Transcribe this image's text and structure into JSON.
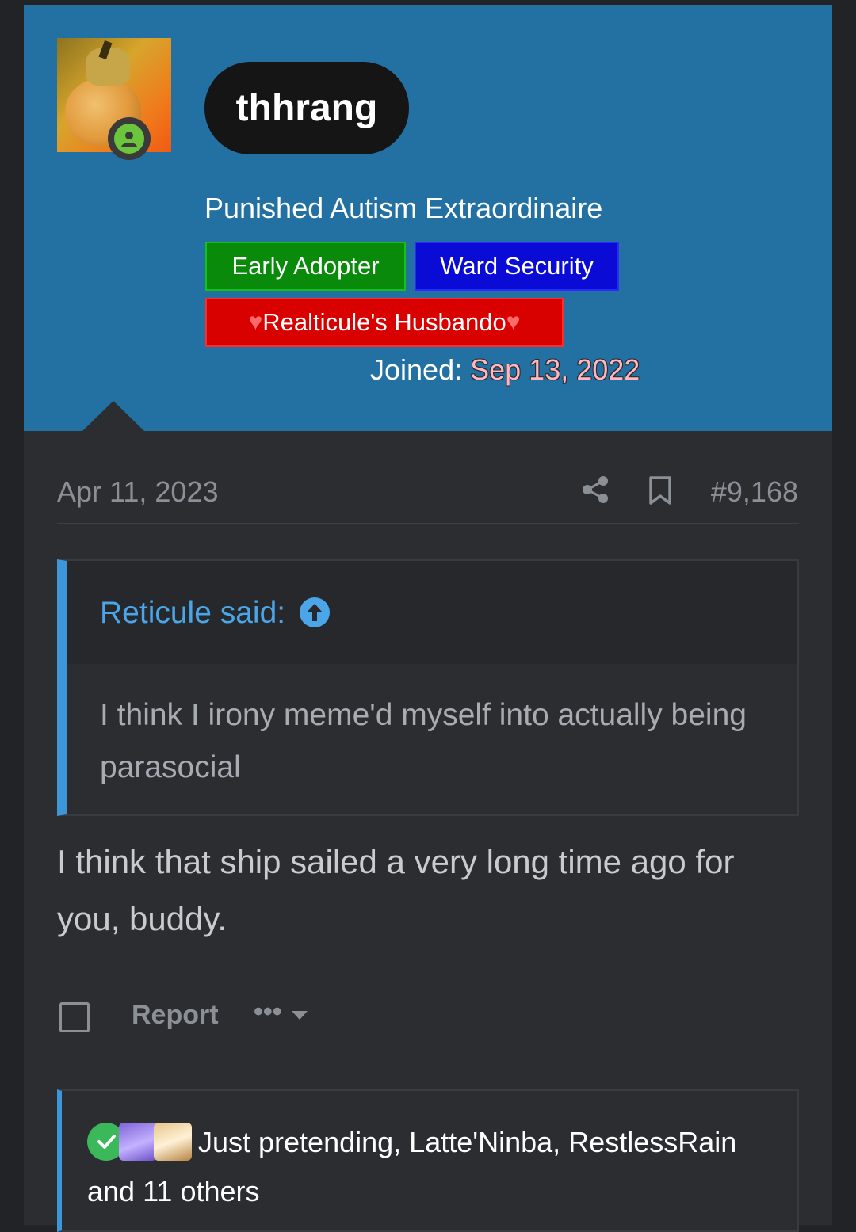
{
  "user": {
    "name": "thhrang",
    "title": "Punished Autism Extraordinaire",
    "banners": [
      "Early Adopter",
      "Ward Security",
      "Realticule's Husbando"
    ],
    "banner_heart": "♥",
    "joined_label": "Joined:",
    "joined_date": "Sep 13, 2022"
  },
  "post": {
    "date": "Apr 11, 2023",
    "number": "#9,168",
    "quote_author": "Reticule said:",
    "quote_text": "I think I irony meme'd myself into actually being parasocial",
    "body": "I think that ship sailed a very long time ago for you, buddy."
  },
  "actions": {
    "report": "Report",
    "more": "•••"
  },
  "reactions": {
    "text": "Just pretending, Latte'Ninba, RestlessRain and 11 others"
  },
  "colors": {
    "user_panel": "#2371a3",
    "accent": "#3d96d9",
    "early_adopter": "#0a8a0a",
    "ward_security": "#0b0bd6",
    "husbando": "#d90000"
  }
}
